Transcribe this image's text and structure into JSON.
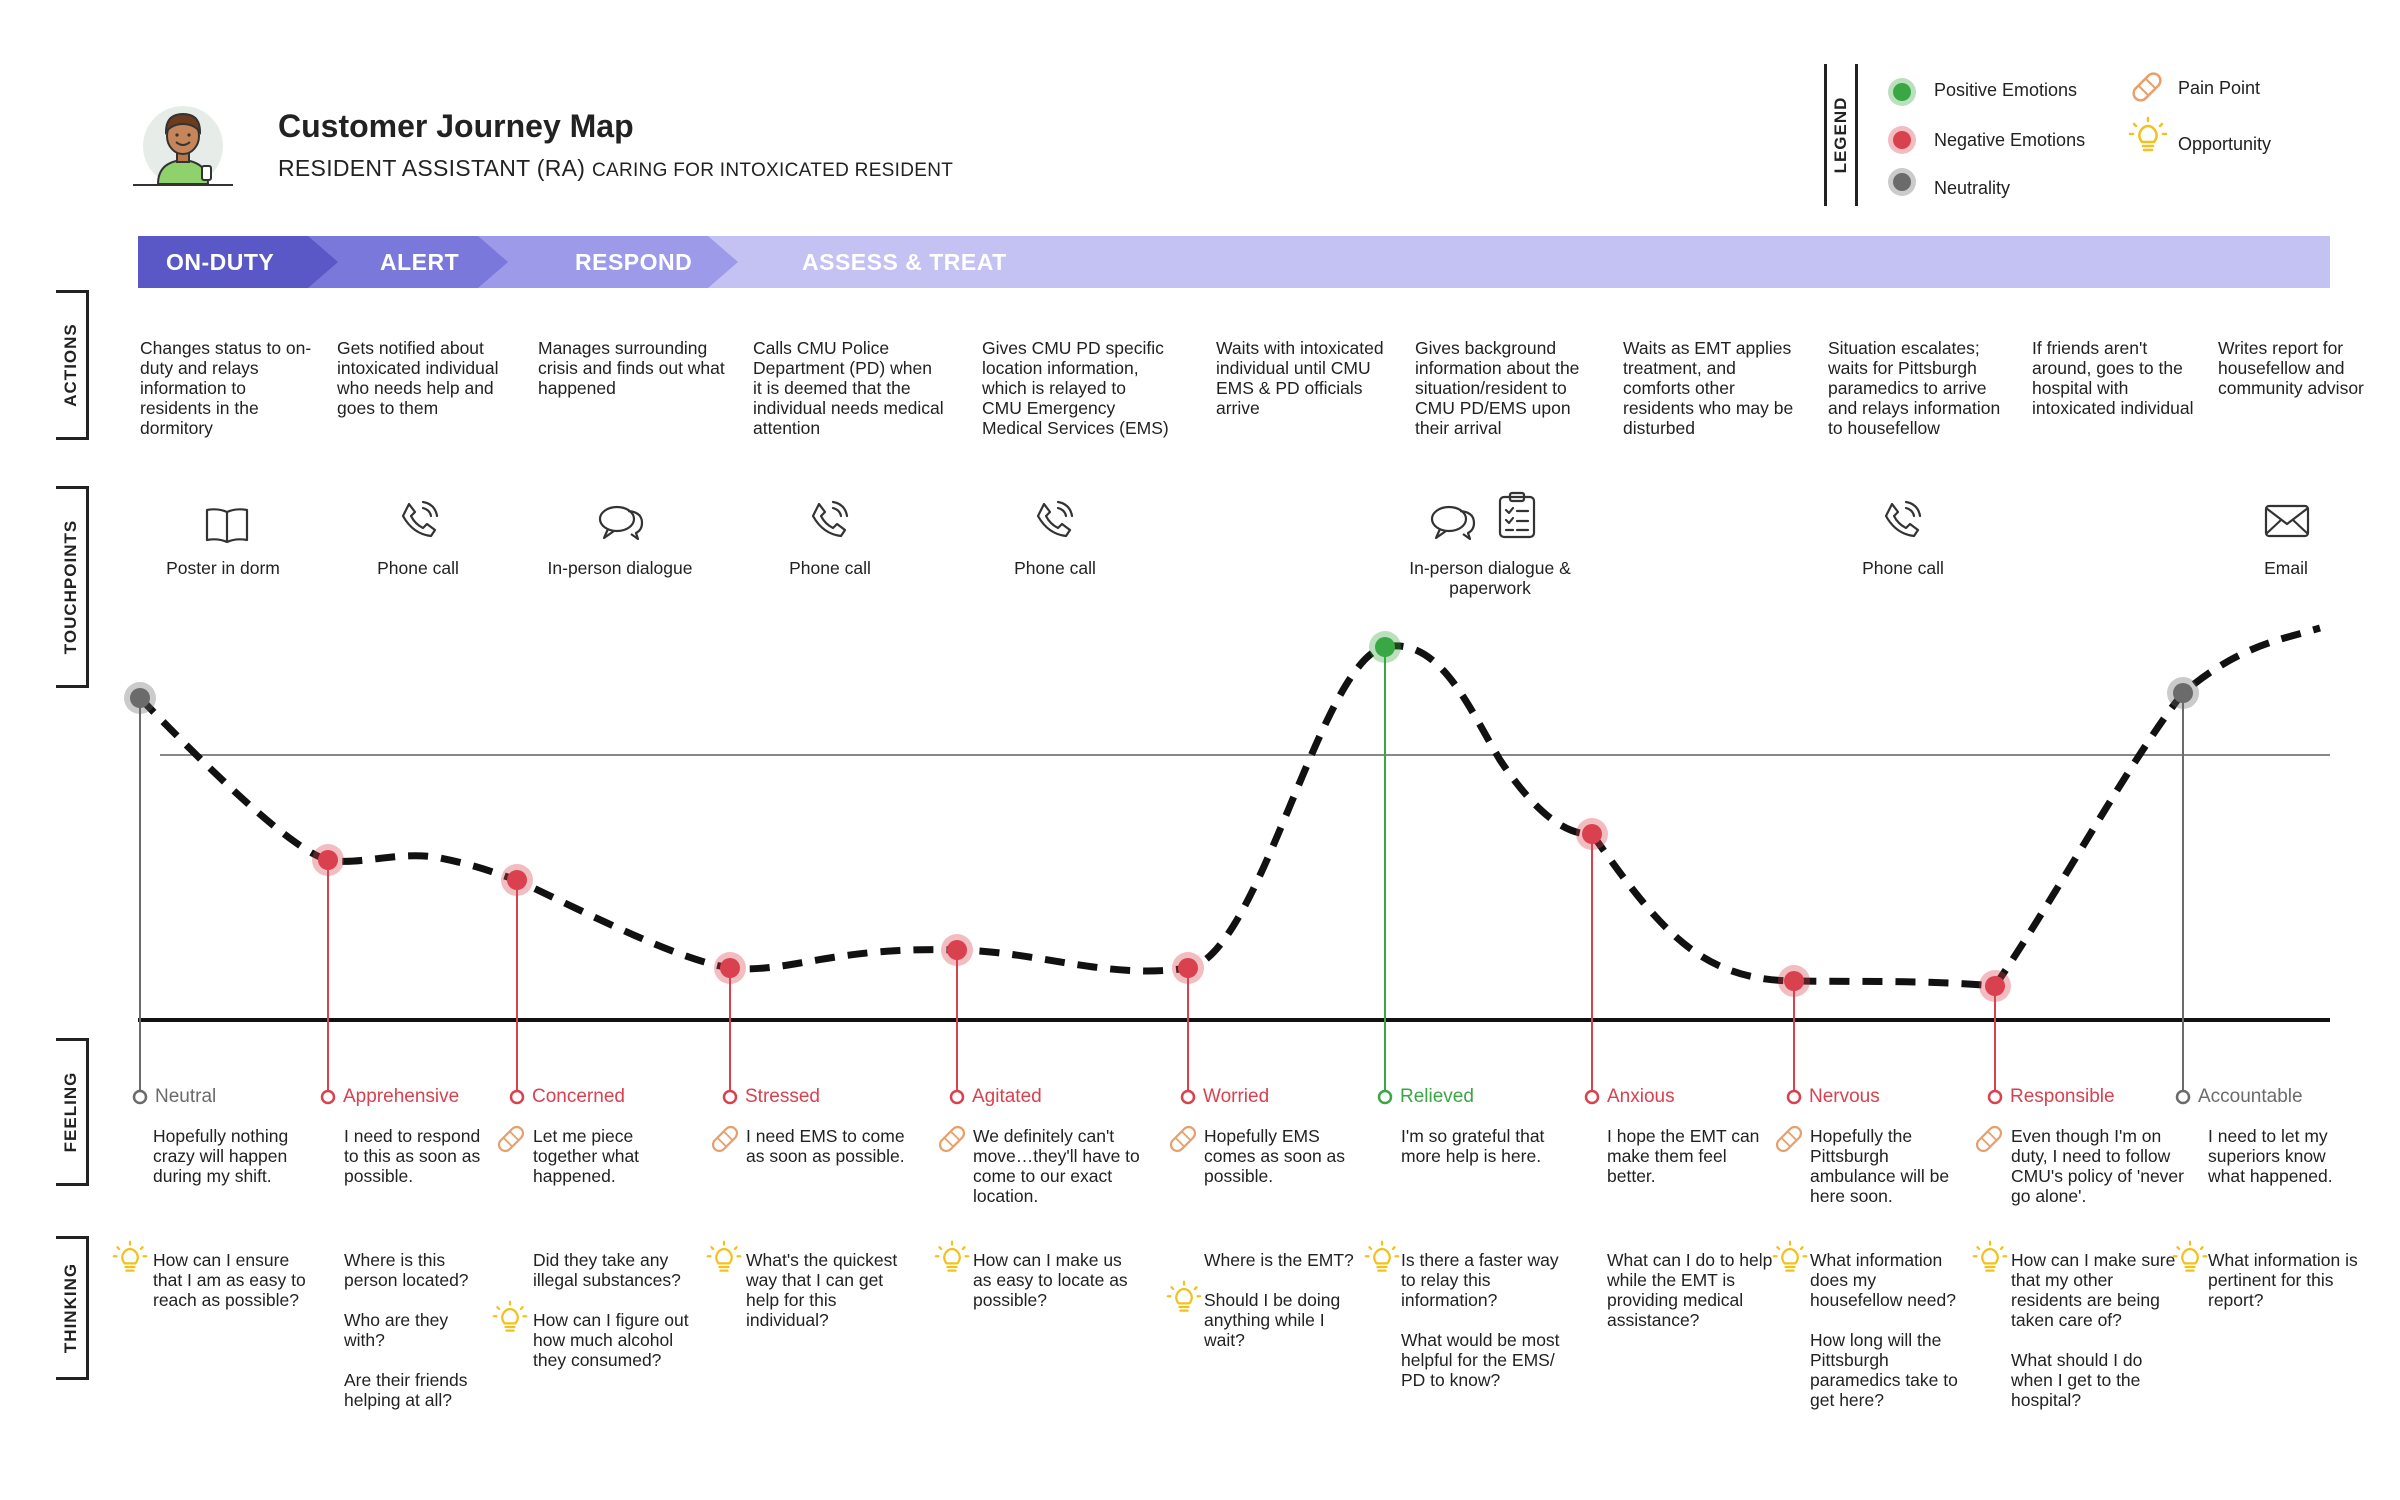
{
  "header": {
    "title": "Customer Journey Map",
    "subtitle_main": "RESIDENT ASSISTANT (RA)",
    "subtitle_small": "CARING FOR INTOXICATED RESIDENT"
  },
  "legend": {
    "label": "LEGEND",
    "items": [
      {
        "label": "Positive Emotions",
        "icon": "green-dot",
        "color": "#3aa745"
      },
      {
        "label": "Negative Emotions",
        "icon": "red-dot",
        "color": "#d9414e"
      },
      {
        "label": "Neutrality",
        "icon": "gray-dot",
        "color": "#6b6b6b"
      },
      {
        "label": "Pain Point",
        "icon": "bandage-icon",
        "color": "#e8a06b"
      },
      {
        "label": "Opportunity",
        "icon": "lightbulb-icon",
        "color": "#f2c21b"
      }
    ]
  },
  "phases": [
    "ON-DUTY",
    "ALERT",
    "RESPOND",
    "ASSESS & TREAT"
  ],
  "sections": [
    "ACTIONS",
    "TOUCHPOINTS",
    "FEELING",
    "THINKING"
  ],
  "actions": [
    "Changes status to on-duty and relays information to residents in the dormitory",
    "Gets notified about intoxicated individual who needs help and goes to them",
    "Manages surrounding crisis and finds out what happened",
    "Calls CMU Police Department (PD) when it is deemed that the individual needs medical attention",
    "Gives CMU PD specific location information, which is relayed to CMU Emergency Medical Services (EMS)",
    "Waits with intoxicated individual until CMU EMS & PD officials arrive",
    "Gives background information about the situation/resident to CMU PD/EMS upon their arrival",
    "Waits as EMT applies treatment, and comforts other residents who may be disturbed",
    "Situation escalates; waits for Pittsburgh paramedics to arrive and relays information to housefellow",
    "If friends aren't around, goes to the hospital with intoxicated individual",
    "Writes report for housefellow and community advisor"
  ],
  "touchpoints": [
    {
      "label": "Poster in dorm",
      "icon": "book-icon"
    },
    {
      "label": "Phone call",
      "icon": "phone-icon"
    },
    {
      "label": "In-person dialogue",
      "icon": "chat-icon"
    },
    {
      "label": "Phone call",
      "icon": "phone-icon"
    },
    {
      "label": "Phone call",
      "icon": "phone-icon"
    },
    {
      "label": "In-person dialogue & paperwork",
      "icon": "chat-clipboard-icon"
    },
    {
      "label": "Phone call",
      "icon": "phone-icon"
    },
    {
      "label": "Email",
      "icon": "envelope-icon"
    }
  ],
  "feelings": [
    {
      "label": "Neutral",
      "type": "neutral",
      "pain": false,
      "text": "Hopefully nothing crazy will happen during my shift."
    },
    {
      "label": "Apprehensive",
      "type": "negative",
      "pain": false,
      "text": "I need to respond to this as soon as possible."
    },
    {
      "label": "Concerned",
      "type": "negative",
      "pain": true,
      "text": "Let me piece together what happened."
    },
    {
      "label": "Stressed",
      "type": "negative",
      "pain": true,
      "text": "I need EMS to come as soon as possible."
    },
    {
      "label": "Agitated",
      "type": "negative",
      "pain": true,
      "text": "We definitely can't move…they'll have to come to our exact location."
    },
    {
      "label": "Worried",
      "type": "negative",
      "pain": true,
      "text": "Hopefully EMS comes as soon as possible."
    },
    {
      "label": "Relieved",
      "type": "positive",
      "pain": false,
      "text": "I'm so grateful that more help is here."
    },
    {
      "label": "Anxious",
      "type": "negative",
      "pain": false,
      "text": "I hope the EMT can make them feel better."
    },
    {
      "label": "Nervous",
      "type": "negative",
      "pain": true,
      "text": "Hopefully the Pittsburgh ambulance will be here soon."
    },
    {
      "label": "Responsible",
      "type": "negative",
      "pain": true,
      "text": "Even though I'm on duty, I need to follow CMU's policy of 'never go alone'."
    },
    {
      "label": "Accountable",
      "type": "neutral",
      "pain": false,
      "text": "I need to let my superiors know what happened."
    }
  ],
  "thinking": [
    [
      {
        "text": "How can I ensure that I am as easy to reach as possible?",
        "opportunity": true
      }
    ],
    [
      {
        "text": "Where is this person located?",
        "opportunity": false
      },
      {
        "text": "Who are they with?",
        "opportunity": false
      },
      {
        "text": "Are their friends helping at all?",
        "opportunity": false
      }
    ],
    [
      {
        "text": "Did they take any illegal substances?",
        "opportunity": false
      },
      {
        "text": "How can I figure out how much alcohol they consumed?",
        "opportunity": true
      }
    ],
    [
      {
        "text": "What's the quickest way that I can get help for this individual?",
        "opportunity": true
      }
    ],
    [
      {
        "text": "How can I make us as easy to locate as possible?",
        "opportunity": true
      }
    ],
    [
      {
        "text": "Where is the EMT?",
        "opportunity": false
      },
      {
        "text": "Should I be doing anything while I wait?",
        "opportunity": true
      }
    ],
    [
      {
        "text": "Is there a faster way to relay this information?",
        "opportunity": true
      },
      {
        "text": "What would be most helpful for the EMS/ PD to know?",
        "opportunity": false
      }
    ],
    [
      {
        "text": "What can I do to help while the EMT is providing medical assistance?",
        "opportunity": false
      }
    ],
    [
      {
        "text": "What information does my housefellow need?",
        "opportunity": true
      },
      {
        "text": "How long will the Pittsburgh paramedics take to get here?",
        "opportunity": false
      }
    ],
    [
      {
        "text": "How can I make sure that my other residents are being taken care of?",
        "opportunity": true
      },
      {
        "text": "What should I do when I get to the hospital?",
        "opportunity": false
      }
    ],
    [
      {
        "text": "What information is pertinent for this report?",
        "opportunity": true
      }
    ]
  ],
  "colors": {
    "positive": "#3aa745",
    "negative": "#d9414e",
    "neutral": "#6b6b6b",
    "phase1": "#5a57c6",
    "phase2": "#7b78db",
    "phase3": "#9d9aea",
    "phase4": "#c3c2f2"
  }
}
